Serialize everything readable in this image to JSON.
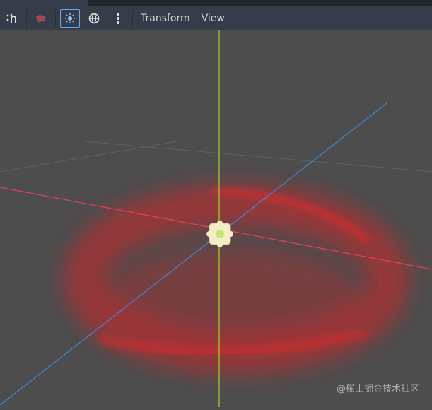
{
  "toolbar": {
    "icons": [
      "snap-icon",
      "camera-icon",
      "sun-light-icon",
      "globe-environment-icon",
      "more-vertical-icon"
    ],
    "menus": {
      "transform": "Transform",
      "view": "View"
    }
  },
  "viewport": {
    "colors": {
      "x_axis": "#e8405a",
      "y_axis": "#9ed62b",
      "z_axis": "#3d8bdb",
      "particles": "#e0282a",
      "background": "#4d4d4d"
    }
  },
  "watermark": "@稀土掘金技术社区"
}
